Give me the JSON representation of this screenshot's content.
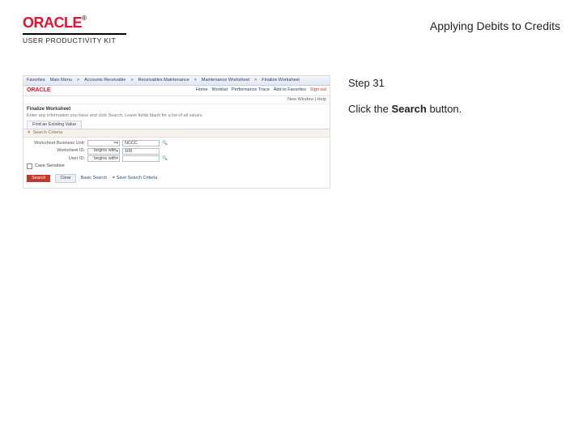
{
  "header": {
    "logo_text": "ORACLE",
    "logo_tm": "®",
    "product_line": "USER PRODUCTIVITY KIT",
    "topic_title": "Applying Debits to Credits"
  },
  "instruction": {
    "step_label": "Step 31",
    "text_before": "Click the ",
    "bold_word": "Search",
    "text_after": " button."
  },
  "screenshot": {
    "tabs": {
      "t1": "Favorites",
      "t2": "Main Menu",
      "t3": "Accounts Receivable",
      "t4": "Receivables Maintenance",
      "t5": "Maintenance Worksheet",
      "t6": "Finalize Worksheet"
    },
    "brand": "ORACLE",
    "toplinks": {
      "home": "Home",
      "worklist": "Worklist",
      "perf": "Performance Trace",
      "addto": "Add to Favorites",
      "signout": "Sign out"
    },
    "subrow": "New Window | Help",
    "page_title": "Finalize Worksheet",
    "page_desc": "Enter any information you have and click Search. Leave fields blank for a list of all values.",
    "pane_tab": "Find an Existing Value",
    "search_header": "Search Criteria",
    "fields": {
      "bu_label": "Worksheet Business Unit:",
      "bu_op": "=",
      "bu_val": "NCCC",
      "ws_label": "Worksheet ID:",
      "ws_op": "begins with",
      "ws_val": "108",
      "user_label": "User ID:",
      "user_op": "begins with",
      "user_val": "",
      "cs_label": "Case Sensitive"
    },
    "buttons": {
      "search": "Search",
      "clear": "Clear",
      "basic": "Basic Search",
      "save": "Save Search Criteria"
    },
    "lookup_icon": "🔍"
  }
}
